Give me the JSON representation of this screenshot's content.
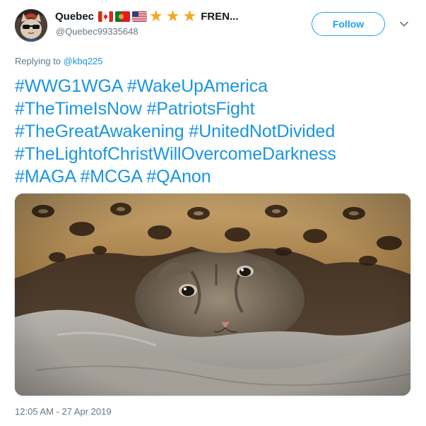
{
  "user": {
    "display_name": "Quebec",
    "name_suffix": "FREN...",
    "handle": "@Quebec99335648",
    "flags": [
      "canada-flag-icon",
      "portugal-flag-icon",
      "usa-flag-icon"
    ],
    "stars": [
      "star-icon",
      "star-icon",
      "star-icon"
    ],
    "avatar": "cat-with-sunglasses-avatar"
  },
  "follow_button": {
    "label": "Follow"
  },
  "menu": {
    "icon": "chevron-down-icon"
  },
  "reply": {
    "prefix": "Replying to",
    "mention": "@kbq225"
  },
  "tweet": {
    "lines": [
      "#WWG1WGA #WakeUpAmerica",
      "#TheTimeIsNow #PatriotsFight",
      "#TheGreatAwakening #UnitedNotDivided",
      "#TheLightofChristWillOvercomeDarkness",
      "#MAGA #MCGA #QAnon"
    ]
  },
  "media": {
    "subject": "tabby kitten under leopard print blanket"
  },
  "timestamp": "12:05 AM - 27 Apr 2019",
  "colors": {
    "link": "#1b95e0",
    "follow": "#1da1f2",
    "muted": "#657786",
    "star": "#f4a81d"
  }
}
